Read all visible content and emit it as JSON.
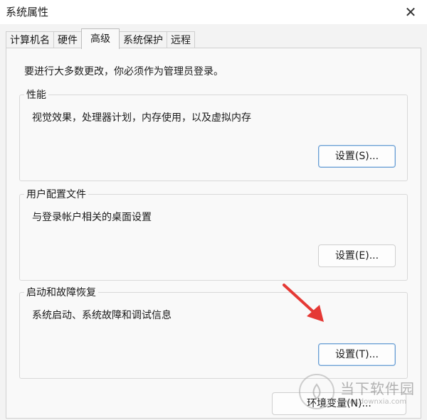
{
  "window": {
    "title": "系统属性",
    "close_glyph": "✕"
  },
  "tabs": [
    {
      "label": "计算机名"
    },
    {
      "label": "硬件"
    },
    {
      "label": "高级"
    },
    {
      "label": "系统保护"
    },
    {
      "label": "远程"
    }
  ],
  "active_tab": "高级",
  "admin_note": "要进行大多数更改，你必须作为管理员登录。",
  "groups": {
    "performance": {
      "legend": "性能",
      "desc": "视觉效果，处理器计划，内存使用，以及虚拟内存",
      "button": "设置(S)..."
    },
    "user_profiles": {
      "legend": "用户配置文件",
      "desc": "与登录帐户相关的桌面设置",
      "button": "设置(E)..."
    },
    "startup_recovery": {
      "legend": "启动和故障恢复",
      "desc": "系统启动、系统故障和调试信息",
      "button": "设置(T)..."
    }
  },
  "env_button": "环境变量(N)...",
  "annotation": {
    "arrow_color": "#e53935"
  },
  "watermark": {
    "name": "当下软件园",
    "url": "www.downxia.com"
  }
}
